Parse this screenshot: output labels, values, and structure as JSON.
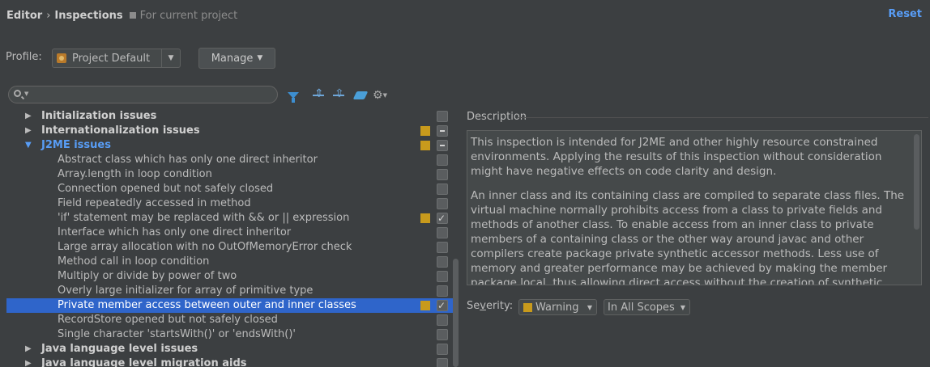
{
  "header": {
    "crumb1": "Editor",
    "sep": "›",
    "crumb2": "Inspections",
    "scope_note": "For current project",
    "reset": "Reset"
  },
  "profile": {
    "label": "Profile:",
    "value": "Project Default",
    "manage": "Manage"
  },
  "search": {
    "value": ""
  },
  "tree": [
    {
      "label": "Initialization issues",
      "level": 0,
      "expanded": false,
      "severity": false,
      "checkbox": "off"
    },
    {
      "label": "Internationalization issues",
      "level": 0,
      "expanded": false,
      "severity": true,
      "checkbox": "mixed"
    },
    {
      "label": "J2ME issues",
      "level": 0,
      "expanded": true,
      "severity": true,
      "checkbox": "mixed",
      "highlight": true
    },
    {
      "label": "Abstract class which has only one direct inheritor",
      "level": 1,
      "severity": false,
      "checkbox": "off"
    },
    {
      "label": "Array.length in loop condition",
      "level": 1,
      "severity": false,
      "checkbox": "off"
    },
    {
      "label": "Connection opened but not safely closed",
      "level": 1,
      "severity": false,
      "checkbox": "off"
    },
    {
      "label": "Field repeatedly accessed in method",
      "level": 1,
      "severity": false,
      "checkbox": "off"
    },
    {
      "label": "'if' statement may be replaced with && or || expression",
      "level": 1,
      "severity": true,
      "checkbox": "on"
    },
    {
      "label": "Interface which has only one direct inheritor",
      "level": 1,
      "severity": false,
      "checkbox": "off"
    },
    {
      "label": "Large array allocation with no OutOfMemoryError check",
      "level": 1,
      "severity": false,
      "checkbox": "off"
    },
    {
      "label": "Method call in loop condition",
      "level": 1,
      "severity": false,
      "checkbox": "off"
    },
    {
      "label": "Multiply or divide by power of two",
      "level": 1,
      "severity": false,
      "checkbox": "off"
    },
    {
      "label": "Overly large initializer for array of primitive type",
      "level": 1,
      "severity": false,
      "checkbox": "off"
    },
    {
      "label": "Private member access between outer and inner classes",
      "level": 1,
      "severity": true,
      "checkbox": "on",
      "selected": true
    },
    {
      "label": "RecordStore opened but not safely closed",
      "level": 1,
      "severity": false,
      "checkbox": "off"
    },
    {
      "label": "Single character 'startsWith()' or 'endsWith()'",
      "level": 1,
      "severity": false,
      "checkbox": "off"
    },
    {
      "label": "Java language level issues",
      "level": 0,
      "expanded": false,
      "severity": false,
      "checkbox": "off"
    },
    {
      "label": "Java language level migration aids",
      "level": 0,
      "expanded": false,
      "severity": false,
      "checkbox": "off"
    }
  ],
  "description": {
    "label": "Description",
    "paragraphs": [
      "This inspection is intended for J2ME and other highly resource constrained environments. Applying the results of this inspection without consideration might have negative effects on code clarity and design.",
      "An inner class and its containing class are compiled to separate class files. The virtual machine normally prohibits access from a class to private fields and methods of another class. To enable access from an inner class to private members of a containing class or the other way around javac and other compilers create package private synthetic accessor methods. Less use of memory and greater performance may be achieved by making the member package local, thus allowing direct access without the creation of synthetic accessor methods."
    ]
  },
  "severity": {
    "label_prefix": "Se",
    "label_u": "v",
    "label_suffix": "erity:",
    "value": "Warning",
    "scope": "In All Scopes"
  },
  "colors": {
    "background": "#3c3f41",
    "selection": "#2f65ca",
    "link": "#589df6",
    "warning": "#c89a1c"
  }
}
